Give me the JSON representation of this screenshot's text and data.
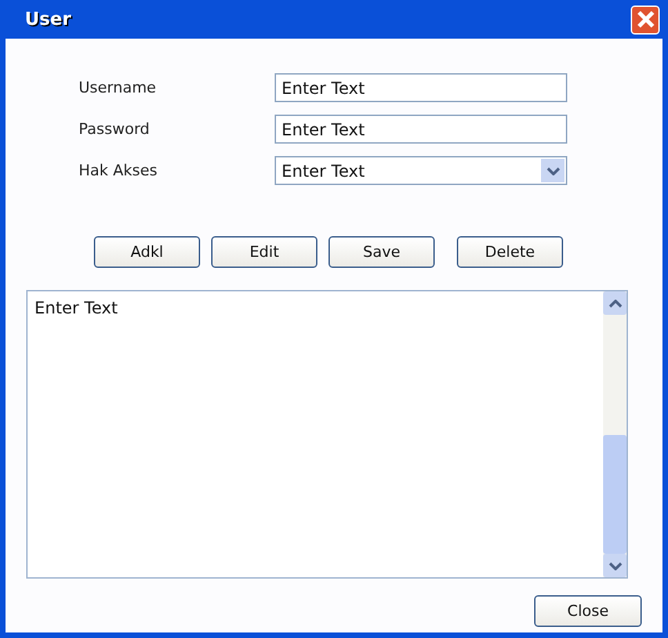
{
  "window": {
    "title": "User"
  },
  "fields": [
    {
      "label": "Username",
      "kind": "text",
      "placeholder": "Enter Text"
    },
    {
      "label": "Password",
      "kind": "text",
      "placeholder": "Enter Text"
    },
    {
      "label": "Hak Akses",
      "kind": "dropdown",
      "placeholder": "Enter Text"
    }
  ],
  "buttons": [
    "Adkl",
    "Edit",
    "Save",
    "Delete"
  ],
  "text_area": {
    "placeholder": "Enter Text"
  },
  "close_button": "Close"
}
